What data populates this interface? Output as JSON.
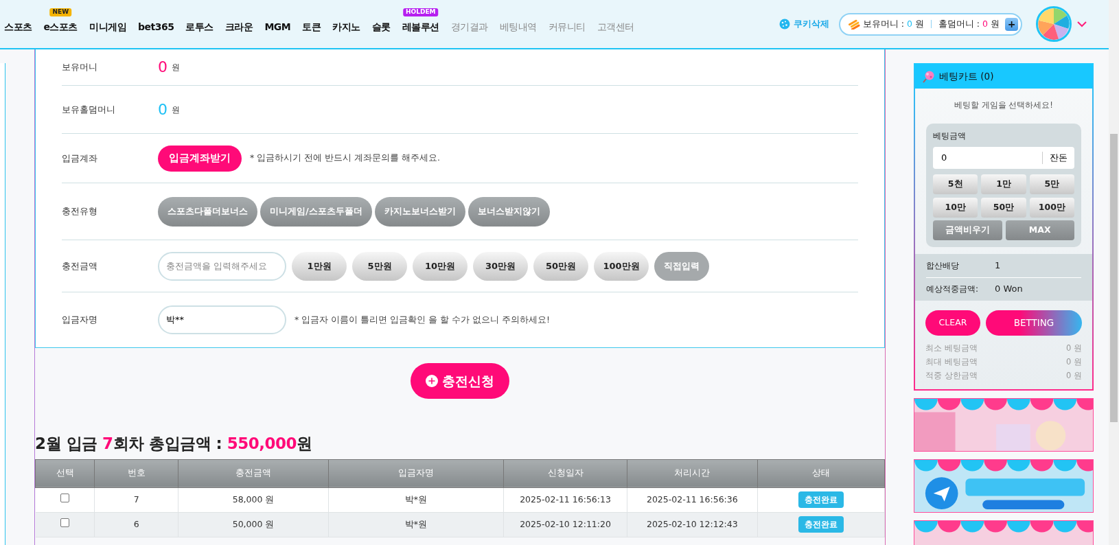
{
  "nav": {
    "items": [
      {
        "label": "스포츠",
        "kind": "main"
      },
      {
        "label": "e스포츠",
        "kind": "main",
        "badge": {
          "text": "NEW",
          "color": "#f5b400"
        }
      },
      {
        "label": "미니게임",
        "kind": "main"
      },
      {
        "label": "bet365",
        "kind": "main"
      },
      {
        "label": "로투스",
        "kind": "main"
      },
      {
        "label": "크라운",
        "kind": "main"
      },
      {
        "label": "MGM",
        "kind": "main"
      },
      {
        "label": "토큰",
        "kind": "main"
      },
      {
        "label": "카지노",
        "kind": "main"
      },
      {
        "label": "슬롯",
        "kind": "main"
      },
      {
        "label": "레볼루션",
        "kind": "main",
        "badge": {
          "text": "HOLDEM",
          "color": "#b61ff0"
        }
      },
      {
        "label": "경기결과",
        "kind": "sub"
      },
      {
        "label": "베팅내역",
        "kind": "sub"
      },
      {
        "label": "커뮤니티",
        "kind": "sub"
      },
      {
        "label": "고객센터",
        "kind": "sub"
      }
    ],
    "cookie_button": "쿠키삭제",
    "wallet": {
      "money_label": "보유머니 :",
      "money_value": "0",
      "money_unit": "원",
      "holdem_label": "홀덤머니 :",
      "holdem_value": "0",
      "holdem_unit": "원",
      "add_button": "+"
    }
  },
  "form": {
    "rows": [
      {
        "kind": "balance",
        "label": "보유머니",
        "value": "0",
        "unit": "원",
        "color": "#ff0a78"
      },
      {
        "kind": "balance",
        "label": "보유홀덤머니",
        "value": "0",
        "unit": "원",
        "color": "#1ec0f5"
      },
      {
        "kind": "account",
        "label": "입금계좌",
        "button": "입금계좌받기",
        "note": "* 입금하시기 전에 반드시 계좌문의를 해주세요."
      },
      {
        "kind": "options",
        "label": "충전유형",
        "options": [
          "스포츠다폴더보너스",
          "미니게임/스포츠두폴더",
          "카지노보너스받기",
          "보너스받지않기"
        ]
      },
      {
        "kind": "amount",
        "label": "충전금액",
        "placeholder": "충전금액을 입력해주세요",
        "buttons": [
          {
            "label": "1만원",
            "kind": "preset"
          },
          {
            "label": "5만원",
            "kind": "preset"
          },
          {
            "label": "10만원",
            "kind": "preset"
          },
          {
            "label": "30만원",
            "kind": "preset"
          },
          {
            "label": "50만원",
            "kind": "preset"
          },
          {
            "label": "100만원",
            "kind": "preset"
          },
          {
            "label": "직접입력",
            "kind": "direct"
          }
        ]
      },
      {
        "kind": "depositor",
        "label": "입금자명",
        "value": "박**",
        "note": "* 입금자 이름이 틀리면 입금확인 을 할 수가 없으니 주의하세요!"
      }
    ],
    "submit": "충전신청"
  },
  "summary": [
    {
      "text": "2월 입금 ",
      "highlight": false
    },
    {
      "text": "7",
      "highlight": true
    },
    {
      "text": "회차 총입금액 : ",
      "highlight": false
    },
    {
      "text": "550,000",
      "highlight": true
    },
    {
      "text": "원",
      "highlight": false
    }
  ],
  "table": {
    "columns": [
      "선택",
      "번호",
      "충전금액",
      "입금자명",
      "신청일자",
      "처리시간",
      "상태"
    ],
    "rows": [
      {
        "checked": false,
        "number": "7",
        "amount": "58,000 원",
        "name": "박*원",
        "requested": "2025-02-11 16:56:13",
        "processed": "2025-02-11 16:56:36",
        "status": "충전완료"
      },
      {
        "checked": false,
        "number": "6",
        "amount": "50,000 원",
        "name": "박*원",
        "requested": "2025-02-10 12:11:20",
        "processed": "2025-02-10 12:12:43",
        "status": "충전완료"
      }
    ]
  },
  "cart": {
    "title": "베팅카트 (0)",
    "prompt": "베팅할 게임을 선택하세요!",
    "amount_label": "베팅금액",
    "amount_value": "0",
    "change_button": "잔돈",
    "chips": [
      "5천",
      "1만",
      "5만",
      "10만",
      "50만",
      "100만"
    ],
    "actions": [
      "금액비우기",
      "MAX"
    ],
    "summary": [
      {
        "label": "합산배당",
        "value": "1"
      },
      {
        "label": "예상적중금액:",
        "value": "0 Won"
      }
    ],
    "clear_button": "CLEAR",
    "bet_button": "BETTING",
    "limits": [
      {
        "label": "최소 베팅금액",
        "value": "0 원"
      },
      {
        "label": "최대 베팅금액",
        "value": "0 원"
      },
      {
        "label": "적중 상한금액",
        "value": "0 원"
      }
    ]
  }
}
